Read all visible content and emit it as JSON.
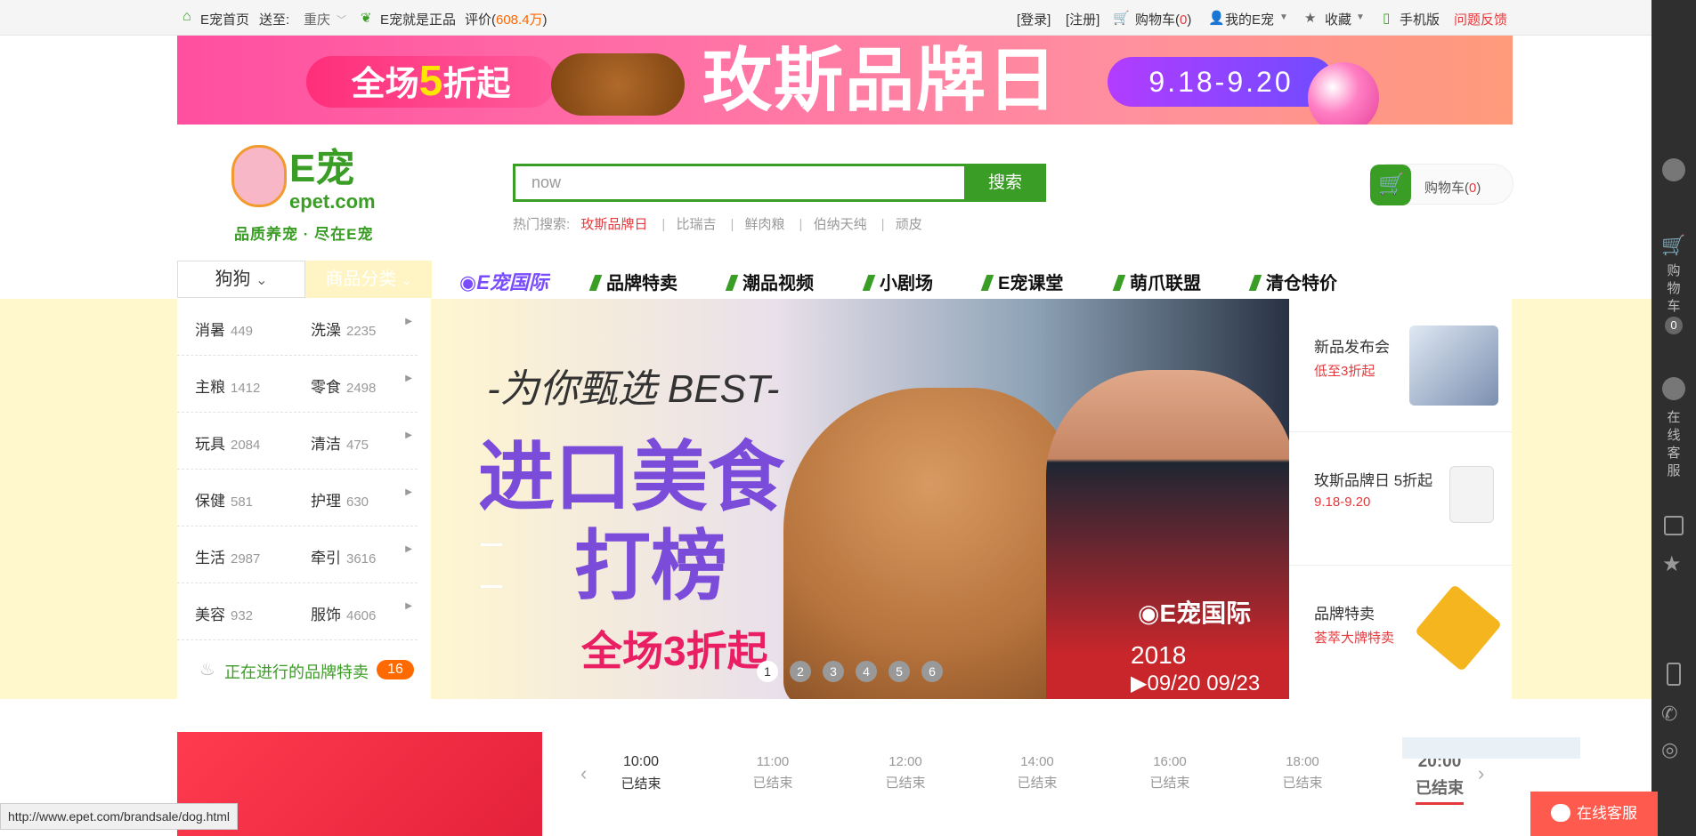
{
  "topbar": {
    "home": "E宠首页",
    "deliver_label": "送至:",
    "deliver_city": "重庆",
    "genuine": "E宠就是正品",
    "rating_label": "评价(",
    "rating_value": "608.4万",
    "rating_close": ")",
    "login": "[登录]",
    "register": "[注册]",
    "cart": "购物车(",
    "cart_count": "0",
    "cart_close": ")",
    "my_epet": "我的E宠",
    "favorites": "收藏",
    "mobile": "手机版",
    "feedback": "问题反馈"
  },
  "banner": {
    "left_pre": "全场",
    "left_num": "5",
    "left_post": "折起",
    "title": "玫斯品牌日",
    "dates": "9.18-9.20"
  },
  "header": {
    "logo_text": "E宠",
    "logo_domain": "epet.com",
    "slogan": "品质养宠 · 尽在E宠",
    "search_value": "now",
    "search_button": "搜索",
    "hot_label": "热门搜索:",
    "hot_terms": [
      "玫斯品牌日",
      "比瑞吉",
      "鲜肉粮",
      "伯纳天纯",
      "顽皮"
    ],
    "cart_label": "购物车(",
    "cart_count": "0",
    "cart_close": ")"
  },
  "nav": {
    "pet_select": "狗狗",
    "category": "商品分类",
    "intl": "E宠国际",
    "items": [
      "品牌特卖",
      "潮品视频",
      "小剧场",
      "E宠课堂",
      "萌爪联盟",
      "清仓特价"
    ]
  },
  "categories": [
    {
      "a": "消暑",
      "a_n": "449",
      "b": "洗澡",
      "b_n": "2235"
    },
    {
      "a": "主粮",
      "a_n": "1412",
      "b": "零食",
      "b_n": "2498"
    },
    {
      "a": "玩具",
      "a_n": "2084",
      "b": "清洁",
      "b_n": "475"
    },
    {
      "a": "保健",
      "a_n": "581",
      "b": "护理",
      "b_n": "630"
    },
    {
      "a": "生活",
      "a_n": "2987",
      "b": "牵引",
      "b_n": "3616"
    },
    {
      "a": "美容",
      "a_n": "932",
      "b": "服饰",
      "b_n": "4606"
    }
  ],
  "brand_sale": {
    "label": "正在进行的品牌特卖",
    "count": "16"
  },
  "slider": {
    "subtitle": "-为你甄选 BEST-",
    "headline1": "进口美食",
    "headline2": "打榜",
    "sale": "全场3折起",
    "brand": "E宠国际",
    "year": "2018",
    "dates": "09/20  09/23",
    "dots": [
      "1",
      "2",
      "3",
      "4",
      "5",
      "6"
    ]
  },
  "promos": [
    {
      "title": "新品发布会",
      "sub": "低至3折起"
    },
    {
      "title": "玫斯品牌日 5折起",
      "sub": "9.18-9.20"
    },
    {
      "title": "品牌特卖",
      "sub": "荟萃大牌特卖"
    }
  ],
  "flash": {
    "slots": [
      {
        "time": "10:00",
        "status": "已结束"
      },
      {
        "time": "11:00",
        "status": "已结束"
      },
      {
        "time": "12:00",
        "status": "已结束"
      },
      {
        "time": "14:00",
        "status": "已结束"
      },
      {
        "time": "16:00",
        "status": "已结束"
      },
      {
        "time": "18:00",
        "status": "已结束"
      },
      {
        "time": "20:00",
        "status": "已结束"
      }
    ]
  },
  "sidebar": {
    "cart": "购物车",
    "cart_count": "0",
    "service": "在线客服"
  },
  "chat_button": "在线客服",
  "status_url": "http://www.epet.com/brandsale/dog.html",
  "colors": {
    "brand_green": "#3a9d25",
    "accent_red": "#e4393c",
    "promo_orange": "#ff6a00"
  }
}
